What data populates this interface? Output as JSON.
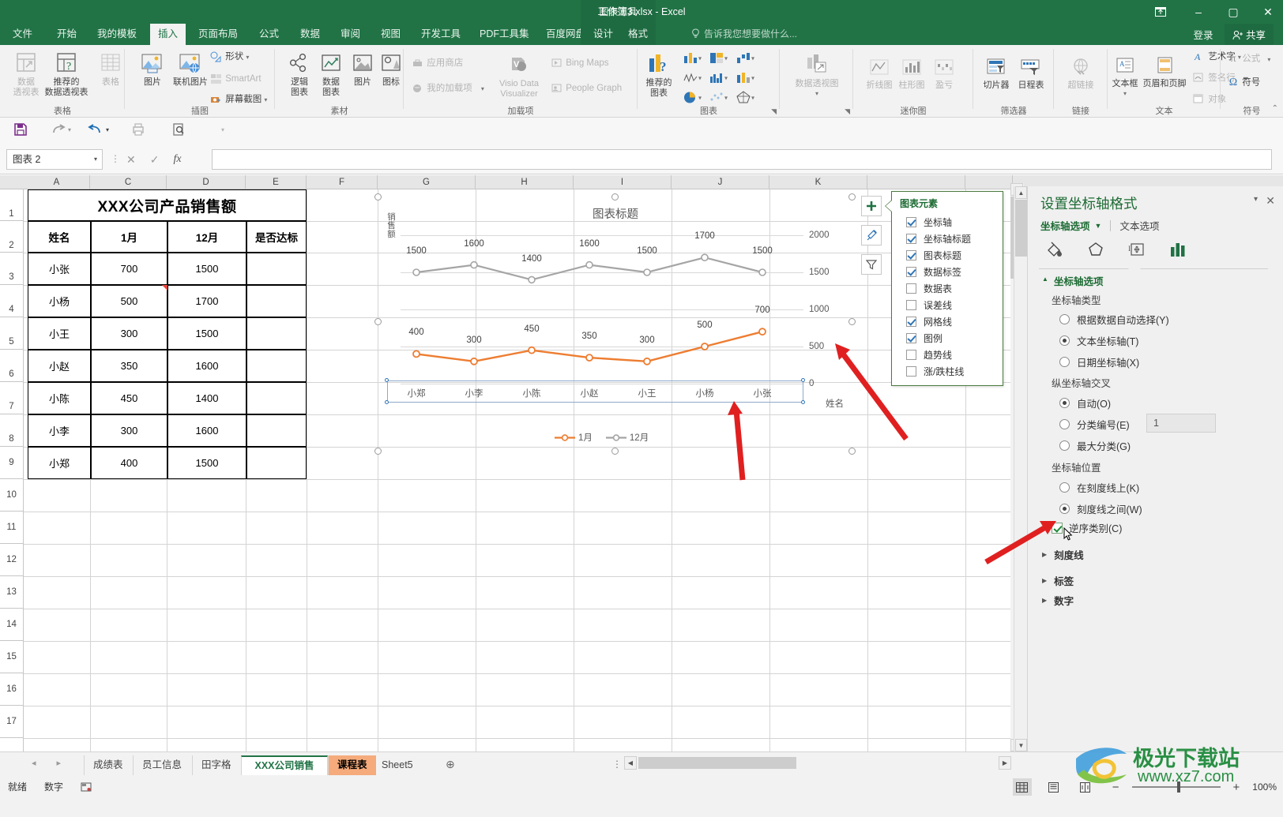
{
  "window": {
    "title": "工作簿3.xlsx - Excel",
    "context_tab_group": "图表工具",
    "ribbon_display_icon": "ribbon-display-options-icon",
    "minimize": "–",
    "maximize": "▢",
    "close": "✕",
    "signin": "登录",
    "share": "共享"
  },
  "tabs": {
    "items": [
      "文件",
      "开始",
      "我的模板",
      "插入",
      "页面布局",
      "公式",
      "数据",
      "审阅",
      "视图",
      "开发工具",
      "PDF工具集",
      "百度网盘"
    ],
    "active": "插入",
    "context_tabs": [
      "设计",
      "格式"
    ],
    "tellme": "告诉我您想要做什么..."
  },
  "ribbon": {
    "groups": [
      {
        "name": "表格",
        "items": [
          "数据透视表",
          "推荐的数据透视表",
          "表格"
        ]
      },
      {
        "name": "插图",
        "items": [
          "图片",
          "联机图片",
          "形状",
          "SmartArt",
          "屏幕截图"
        ]
      },
      {
        "name": "素材",
        "items": [
          "逻辑图表",
          "数据图表",
          "图片",
          "图标"
        ]
      },
      {
        "name": "加载项",
        "items": [
          "应用商店",
          "我的加载项",
          "Visio Data Visualizer",
          "Bing Maps",
          "People Graph"
        ]
      },
      {
        "name": "图表",
        "items": [
          "推荐的图表",
          "数据透视图"
        ]
      },
      {
        "name": "迷你图",
        "items": [
          "折线图",
          "柱形图",
          "盈亏"
        ]
      },
      {
        "name": "筛选器",
        "items": [
          "切片器",
          "日程表"
        ]
      },
      {
        "name": "链接",
        "items": [
          "超链接"
        ]
      },
      {
        "name": "文本",
        "items": [
          "文本框",
          "页眉和页脚",
          "艺术字",
          "签名行",
          "对象"
        ]
      },
      {
        "name": "符号",
        "items": [
          "公式",
          "符号"
        ]
      }
    ],
    "labels": {
      "pivot_table": "数据\n透视表",
      "pivot_table_l1": "数据",
      "pivot_table_l2": "透视表",
      "rec_pivot_l1": "推荐的",
      "rec_pivot_l2": "数据透视表",
      "table": "表格",
      "picture": "图片",
      "online_picture": "联机图片",
      "shapes": "形状",
      "smartart": "SmartArt",
      "screenshot": "屏幕截图",
      "logic_l1": "逻辑",
      "logic_l2": "图表",
      "datachart_l1": "数据",
      "datachart_l2": "图表",
      "material_picture": "图片",
      "icons": "图标",
      "store": "应用商店",
      "myaddins": "我的加载项",
      "visio_l1": "Visio Data",
      "visio_l2": "Visualizer",
      "bingmaps": "Bing Maps",
      "peoplegraph": "People Graph",
      "rec_chart_l1": "推荐的",
      "rec_chart_l2": "图表",
      "pivotchart": "数据透视图",
      "sparkline_line": "折线图",
      "sparkline_col": "柱形图",
      "sparkline_wl": "盈亏",
      "slicer": "切片器",
      "timeline": "日程表",
      "hyperlink": "超链接",
      "textbox": "文本框",
      "headerfooter": "页眉和页脚",
      "wordart": "艺术字",
      "signline": "签名行",
      "object": "对象",
      "equation": "公式",
      "symbol": "符号"
    }
  },
  "formula_bar": {
    "name_box": "图表 2",
    "value": "",
    "cancel_icon": "cancel-icon",
    "confirm_icon": "confirm-icon",
    "fx_icon": "fx-icon"
  },
  "grid": {
    "columns": [
      "A",
      "C",
      "D",
      "E",
      "F",
      "G",
      "H",
      "I",
      "J",
      "K"
    ],
    "rows": [
      "1",
      "2",
      "3",
      "4",
      "5",
      "6",
      "7",
      "8",
      "9",
      "10",
      "11",
      "12",
      "13",
      "14",
      "15",
      "16",
      "17"
    ]
  },
  "sheet_table": {
    "title": "XXX公司产品销售额",
    "headers": [
      "姓名",
      "1月",
      "12月",
      "是否达标"
    ],
    "rows": [
      [
        "小张",
        "700",
        "1500",
        ""
      ],
      [
        "小杨",
        "500",
        "1700",
        ""
      ],
      [
        "小王",
        "300",
        "1500",
        ""
      ],
      [
        "小赵",
        "350",
        "1600",
        ""
      ],
      [
        "小陈",
        "450",
        "1400",
        ""
      ],
      [
        "小李",
        "300",
        "1600",
        ""
      ],
      [
        "小郑",
        "400",
        "1500",
        ""
      ]
    ]
  },
  "chart_data": {
    "type": "line",
    "title": "图表标题",
    "xlabel": "姓名",
    "ylabel": "销售额",
    "categories": [
      "小郑",
      "小李",
      "小陈",
      "小赵",
      "小王",
      "小杨",
      "小张"
    ],
    "series": [
      {
        "name": "1月",
        "values": [
          400,
          300,
          450,
          350,
          300,
          500,
          700
        ],
        "color": "#ED7D31"
      },
      {
        "name": "12月",
        "values": [
          1500,
          1600,
          1400,
          1600,
          1500,
          1700,
          1500
        ],
        "color": "#A5A5A5"
      }
    ],
    "yticks": [
      "0",
      "500",
      "1000",
      "1500",
      "2000"
    ],
    "ylim": [
      0,
      2000
    ],
    "y_axis_position": "right",
    "grid": true,
    "legend_position": "bottom",
    "data_labels": true,
    "reversed_categories": true
  },
  "chart_buttons": {
    "add": "chart-elements-plus-icon",
    "style": "chart-styles-brush-icon",
    "filter": "chart-filter-icon"
  },
  "chart_elements_flyout": {
    "title": "图表元素",
    "items": [
      {
        "label": "坐标轴",
        "checked": true
      },
      {
        "label": "坐标轴标题",
        "checked": true
      },
      {
        "label": "图表标题",
        "checked": true
      },
      {
        "label": "数据标签",
        "checked": true
      },
      {
        "label": "数据表",
        "checked": false
      },
      {
        "label": "误差线",
        "checked": false
      },
      {
        "label": "网格线",
        "checked": true
      },
      {
        "label": "图例",
        "checked": true
      },
      {
        "label": "趋势线",
        "checked": false
      },
      {
        "label": "涨/跌柱线",
        "checked": false
      }
    ]
  },
  "task_pane": {
    "title": "设置坐标轴格式",
    "tab_primary": "坐标轴选项",
    "tab_secondary": "文本选项",
    "close_icon": "close-icon",
    "dropdown_icon": "chevron-down-icon",
    "icon_tabs": [
      "fill-icon",
      "effects-icon",
      "size-properties-icon",
      "axis-options-icon"
    ],
    "section_title": "坐标轴选项",
    "group1_label": "坐标轴类型",
    "group1_options": [
      {
        "label": "根据数据自动选择(Y)",
        "selected": false
      },
      {
        "label": "文本坐标轴(T)",
        "selected": true
      },
      {
        "label": "日期坐标轴(X)",
        "selected": false
      }
    ],
    "group2_label": "纵坐标轴交叉",
    "group2_options": [
      {
        "label": "自动(O)",
        "selected": true
      },
      {
        "label": "分类编号(E)",
        "selected": false
      },
      {
        "label": "最大分类(G)",
        "selected": false
      }
    ],
    "category_number_value": "1",
    "group3_label": "坐标轴位置",
    "group3_options": [
      {
        "label": "在刻度线上(K)",
        "selected": false
      },
      {
        "label": "刻度线之间(W)",
        "selected": true
      }
    ],
    "reverse_order": {
      "label": "逆序类别(C)",
      "checked": true
    },
    "collapsed_sections": [
      "刻度线",
      "标签",
      "数字"
    ]
  },
  "sheet_tabs": {
    "items": [
      "成绩表",
      "员工信息",
      "田字格",
      "XXX公司销售额",
      "课程表",
      "Sheet5"
    ],
    "active": "XXX公司销售额",
    "accent": "课程表",
    "add_label": "⊕",
    "nav_prev": "◂",
    "nav_next": "▸"
  },
  "status_bar": {
    "ready": "就绪",
    "mode": "数字",
    "macro_icon": "record-macro-icon",
    "views": [
      "normal-view-icon",
      "page-layout-icon",
      "page-break-icon"
    ],
    "zoom_out": "−",
    "zoom_in": "+",
    "zoom": "100%"
  },
  "watermark": {
    "text": "极光下载站",
    "url": "www.xz7.com"
  },
  "colors": {
    "excel_green": "#217346",
    "series1": "#ED7D31",
    "series2": "#A5A5A5",
    "accent_tab": "#f5ab7b"
  }
}
